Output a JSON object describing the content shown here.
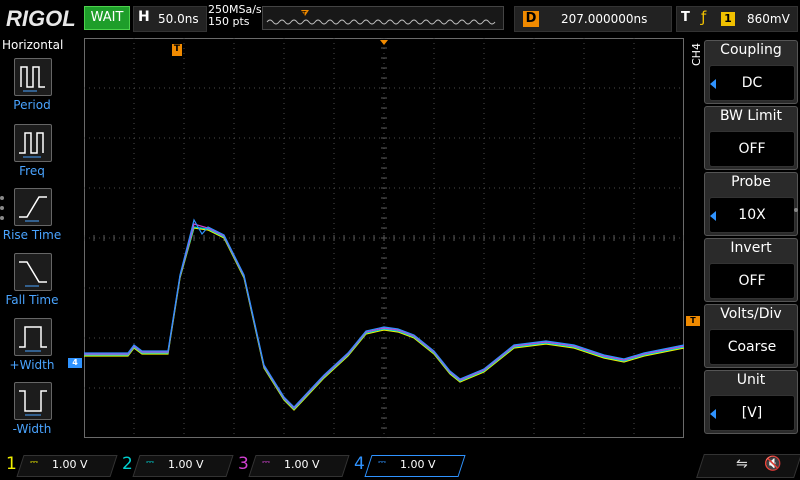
{
  "header": {
    "logo": "RIGOL",
    "run_status": "WAIT",
    "horizontal": {
      "label": "H",
      "timebase": "50.0ns"
    },
    "sample_rate": "250MSa/s",
    "memory_depth": "150 pts",
    "delay": {
      "label": "D",
      "value": "207.000000ns"
    },
    "trigger": {
      "label": "T",
      "edge_icon": "rising-edge-icon",
      "source": "1",
      "level": "860mV"
    }
  },
  "left_menu": {
    "title": "Horizontal",
    "items": [
      {
        "label": "Period",
        "icon": "period-icon"
      },
      {
        "label": "Freq",
        "icon": "frequency-icon"
      },
      {
        "label": "Rise Time",
        "icon": "rise-time-icon"
      },
      {
        "label": "Fall Time",
        "icon": "fall-time-icon"
      },
      {
        "label": "+Width",
        "icon": "positive-width-icon"
      },
      {
        "label": "-Width",
        "icon": "negative-width-icon"
      }
    ]
  },
  "right_menu": {
    "channel_label": "CH4",
    "items": [
      {
        "title": "Coupling",
        "value": "DC",
        "has_arrow": true
      },
      {
        "title": "BW Limit",
        "value": "OFF",
        "has_arrow": false
      },
      {
        "title": "Probe",
        "value": "10X",
        "has_arrow": true
      },
      {
        "title": "Invert",
        "value": "OFF",
        "has_arrow": false
      },
      {
        "title": "Volts/Div",
        "value": "Coarse",
        "has_arrow": false
      },
      {
        "title": "Unit",
        "value": "[V]",
        "has_arrow": true
      }
    ]
  },
  "markers": {
    "trigger_time": "T",
    "trigger_level": "T",
    "ch4_ground": "4"
  },
  "channels": [
    {
      "number": "1",
      "coupling_icon": "dc-coupling-icon",
      "scale": "1.00 V",
      "color": "#f0f000"
    },
    {
      "number": "2",
      "coupling_icon": "dc-coupling-icon",
      "scale": "1.00 V",
      "color": "#00d0d0"
    },
    {
      "number": "3",
      "coupling_icon": "dc-coupling-icon",
      "scale": "1.00 V",
      "color": "#d040d0"
    },
    {
      "number": "4",
      "coupling_icon": "dc-coupling-icon",
      "scale": "1.00 V",
      "color": "#2f93ff"
    }
  ],
  "active_channel": "4",
  "status_icons": [
    "usb-icon",
    "speaker-muted-icon"
  ],
  "colors": {
    "accent": "#2f93ff",
    "trigger": "#f08a00",
    "run_status": "#1e9e2a"
  }
}
